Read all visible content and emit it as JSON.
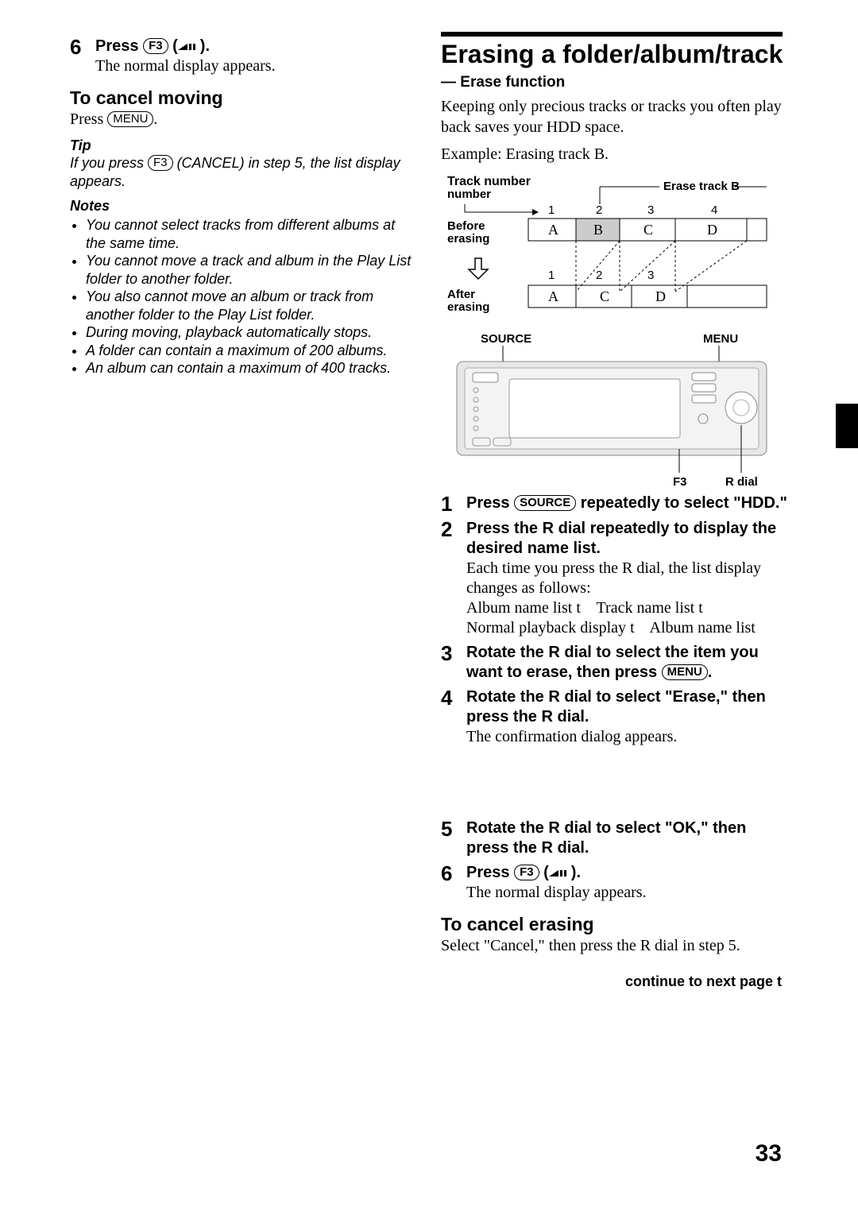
{
  "left": {
    "step6_head_1": "Press ",
    "step6_btn": "F3",
    "step6_head_2": " (",
    "step6_head_3": ").",
    "step6_body": "The normal display appears.",
    "cancel_h": "To cancel moving",
    "cancel_body_1": "Press ",
    "cancel_btn": "MENU",
    "cancel_body_2": ".",
    "tip_h": "Tip",
    "tip_1": "If you press ",
    "tip_btn": "F3",
    "tip_2": " (CANCEL) in step 5, the list display appears.",
    "notes_h": "Notes",
    "notes": [
      "You cannot select tracks from different albums at the same time.",
      "You cannot move a track and album in the Play List folder to another folder.",
      "You also cannot move an album or track from another folder to the Play List folder.",
      "During moving, playback automatically stops.",
      "A folder can contain a maximum of 200 albums.",
      "An album can contain a maximum of 400 tracks."
    ]
  },
  "right": {
    "title": "Erasing a folder/album/track",
    "subtitle": "— Erase function",
    "intro1": "Keeping only precious tracks or tracks you often play back saves your HDD space.",
    "intro2": "Example: Erasing track B.",
    "diag": {
      "track_number": "Track number",
      "erase_b": "Erase track B",
      "before": "Before erasing",
      "after": "After erasing",
      "idx_before": [
        "1",
        "2",
        "3",
        "4"
      ],
      "cells_before": [
        "A",
        "B",
        "C",
        "D"
      ],
      "idx_after": [
        "1",
        "2",
        "3"
      ],
      "cells_after": [
        "A",
        "C",
        "D"
      ]
    },
    "device": {
      "source": "SOURCE",
      "menu": "MENU",
      "f3": "F3",
      "rdial": "R dial"
    },
    "steps": {
      "s1a": "Press ",
      "s1btn": "SOURCE",
      "s1b": " repeatedly to select \"HDD.\"",
      "s2h": "Press the R dial repeatedly to display the desired name list.",
      "s2b1": "Each time you press the R dial, the list display changes as follows:",
      "s2b2a": "Album name list ",
      "s2b2b": " Track name list ",
      "s2b3a": "Normal playback display ",
      "s2b3b": " Album name list",
      "arrow": "t",
      "s3a": "Rotate the R dial to select the item you want to erase, then press ",
      "s3btn": "MENU",
      "s3b": ".",
      "s4h": "Rotate the R dial to select \"Erase,\" then press the R dial.",
      "s4b": "The confirmation dialog appears.",
      "s5h": "Rotate the R dial to select \"OK,\" then press the R dial.",
      "s6a": "Press ",
      "s6btn": "F3",
      "s6b": " (",
      "s6c": ").",
      "s6body": "The normal display appears.",
      "cancel_h": "To cancel erasing",
      "cancel_b": "Select \"Cancel,\" then press the R dial in step 5.",
      "continue": "continue to next page",
      "continue_arrow": "t"
    },
    "pageno": "33"
  }
}
